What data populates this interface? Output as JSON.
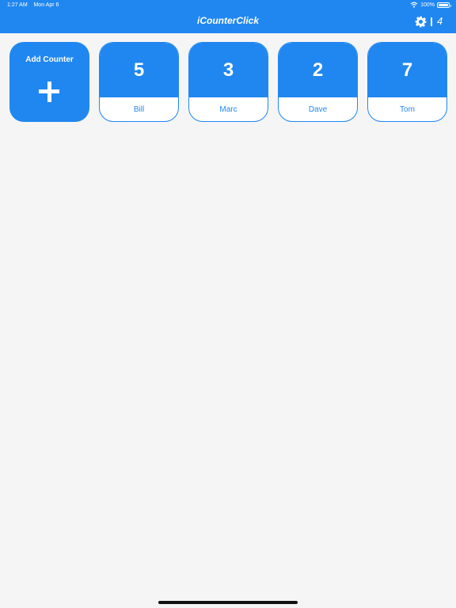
{
  "status_bar": {
    "time": "1:27 AM",
    "date": "Mon Apr 6",
    "battery": "100%",
    "icons": [
      "wifi-icon",
      "battery-icon"
    ]
  },
  "nav": {
    "title": "iCounterClick",
    "count": "4",
    "icons": [
      "gear-icon"
    ]
  },
  "add_counter": {
    "label": "Add Counter",
    "icon": "plus-icon"
  },
  "counters": [
    {
      "value": "5",
      "name": "Bill"
    },
    {
      "value": "3",
      "name": "Marc"
    },
    {
      "value": "2",
      "name": "Dave"
    },
    {
      "value": "7",
      "name": "Tom"
    }
  ],
  "colors": {
    "accent": "#2087f0",
    "background": "#f5f5f5"
  }
}
